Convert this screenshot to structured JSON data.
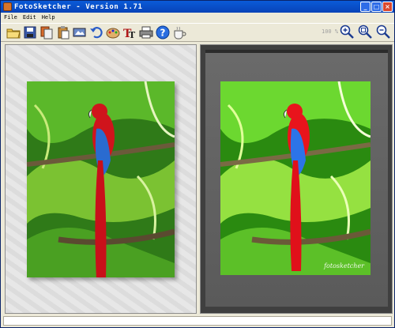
{
  "window": {
    "title": "FotoSketcher - Version 1.71",
    "buttons": [
      "_",
      "□",
      "×"
    ]
  },
  "menu": [
    "File",
    "Edit",
    "Help"
  ],
  "toolbar": {
    "icons": [
      "open-folder-icon",
      "save-icon",
      "copy-original-icon",
      "paste-icon",
      "scan-icon",
      "undo-icon",
      "paint-palette-icon",
      "text-icon",
      "printer-icon",
      "help-icon",
      "coffee-donate-icon"
    ],
    "zoom_label": "100 %",
    "zoom_icons": [
      "zoom-in-icon",
      "zoom-fit-icon",
      "zoom-out-icon"
    ]
  },
  "result": {
    "watermark": "fotosketcher"
  },
  "colors": {
    "titlebar": "#0843b8",
    "parrot_red": "#c8121a",
    "foliage": "#3d9b1e"
  }
}
